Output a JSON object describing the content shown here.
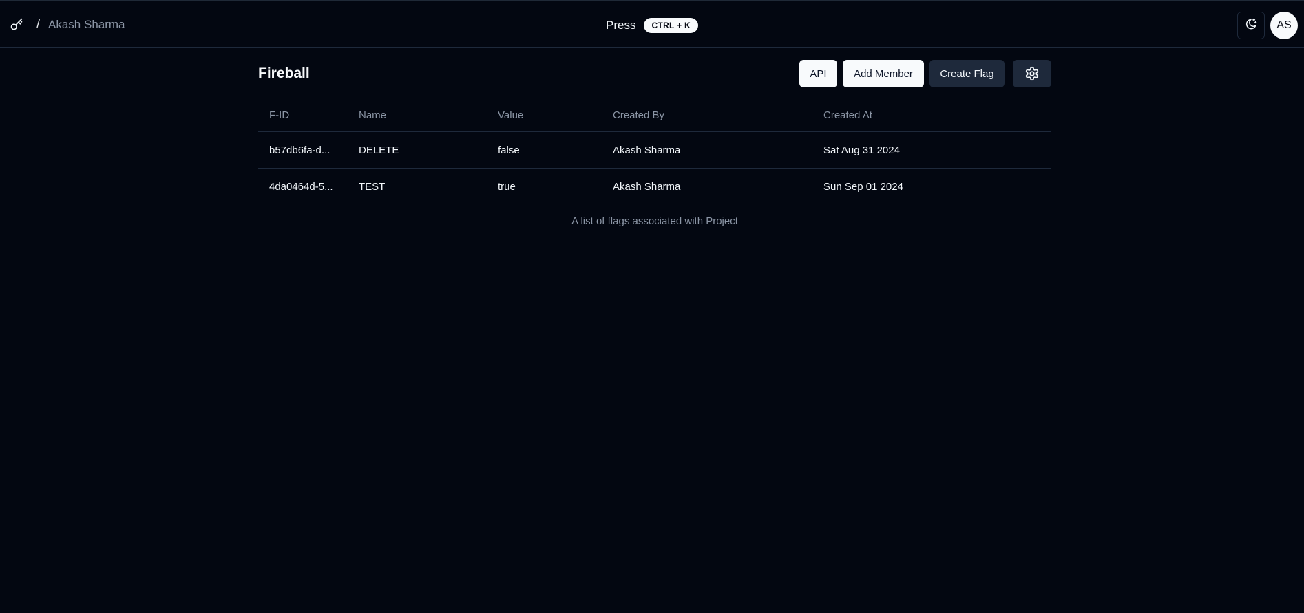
{
  "header": {
    "breadcrumb_separator": "/",
    "user_name": "Akash Sharma",
    "press_label": "Press",
    "shortcut": "CTRL + K",
    "avatar_initials": "AS"
  },
  "project": {
    "title": "Fireball"
  },
  "actions": {
    "api_label": "API",
    "add_member_label": "Add Member",
    "create_flag_label": "Create Flag"
  },
  "table": {
    "columns": [
      "F-ID",
      "Name",
      "Value",
      "Created By",
      "Created At"
    ],
    "rows": [
      [
        "b57db6fa-d...",
        "DELETE",
        "false",
        "Akash Sharma",
        "Sat Aug 31 2024"
      ],
      [
        "4da0464d-5...",
        "TEST",
        "true",
        "Akash Sharma",
        "Sun Sep 01 2024"
      ]
    ],
    "caption": "A list of flags associated with Project"
  },
  "icons": {
    "logo": "key-icon",
    "theme": "moon-sparkle-icon",
    "settings": "gear-icon"
  },
  "colors": {
    "background": "#030711",
    "border": "#1e293b",
    "muted_text": "#8b95a5",
    "primary_light": "#f8fafc",
    "secondary_dark": "#1e293b"
  }
}
